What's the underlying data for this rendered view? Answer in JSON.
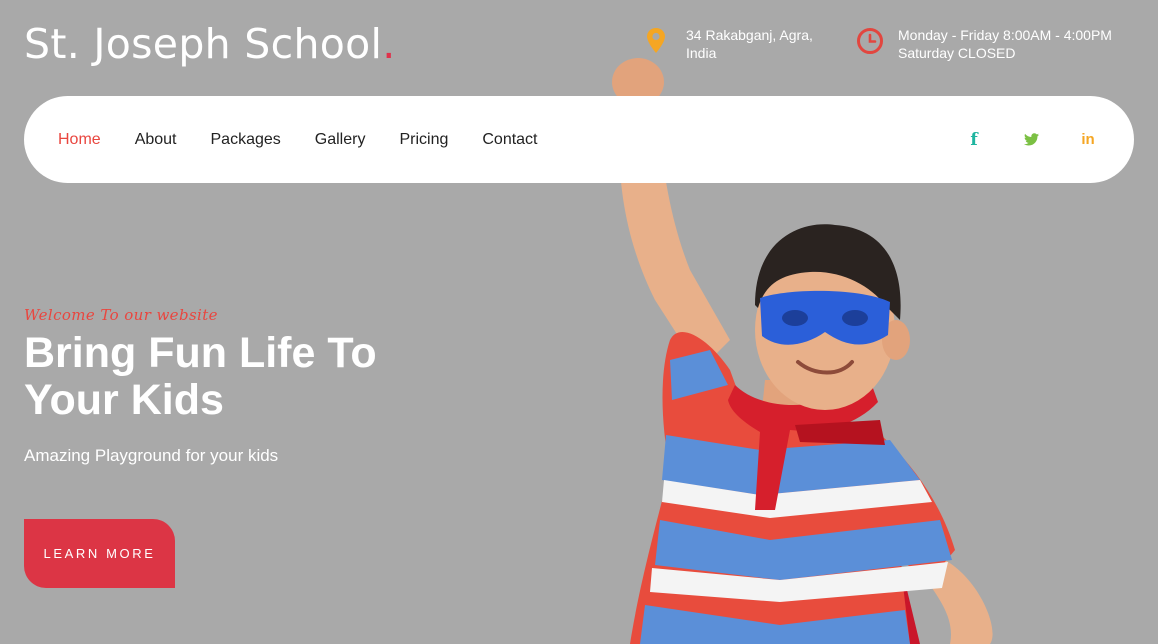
{
  "brand": {
    "name": "St. Joseph School",
    "dot": "."
  },
  "contact": {
    "address_line1": "34 Rakabganj, Agra,",
    "address_line2": "India",
    "address_icon": "map-pin-icon",
    "hours_line1": "Monday - Friday 8:00AM - 4:00PM",
    "hours_line2": "Saturday CLOSED",
    "hours_icon": "clock-icon"
  },
  "nav": {
    "items": [
      "Home",
      "About",
      "Packages",
      "Gallery",
      "Pricing",
      "Contact"
    ],
    "active": "Home"
  },
  "socials": [
    {
      "icon": "facebook-icon",
      "glyph": "f",
      "color": "#1fb5a0"
    },
    {
      "icon": "twitter-icon",
      "glyph": "",
      "color": "#7bc043"
    },
    {
      "icon": "linkedin-icon",
      "glyph": "in",
      "color": "#f5a623"
    }
  ],
  "hero": {
    "welcome": "Welcome To our website",
    "headline": "Bring Fun Life To Your Kids",
    "subline": "Amazing Playground for your kids",
    "cta": "LEARN MORE"
  },
  "colors": {
    "background": "#a9a9a9",
    "accent_red": "#e9463f",
    "button_red": "#dc3545",
    "pin_orange": "#f5a623",
    "clock_red": "#e2463f"
  }
}
